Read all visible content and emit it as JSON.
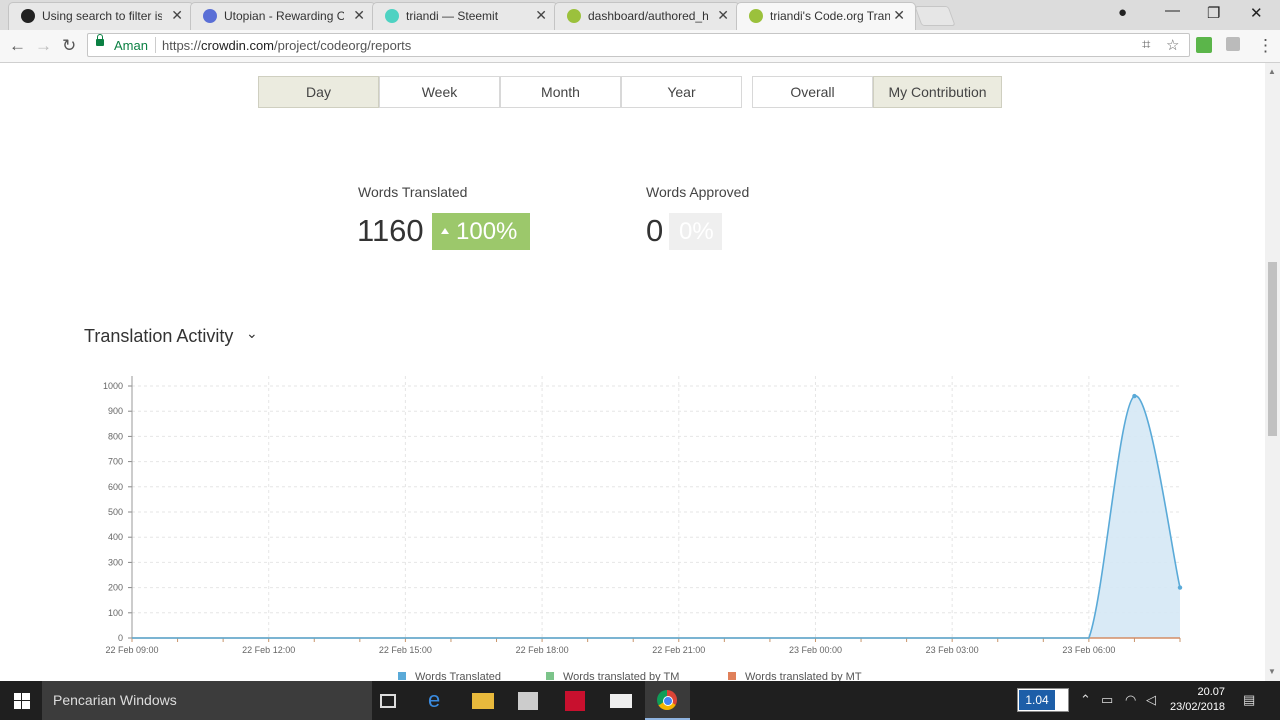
{
  "browser": {
    "tabs": [
      {
        "title": "Using search to filter issu",
        "favicon_color": "#222222"
      },
      {
        "title": "Utopian - Rewarding Op",
        "favicon_color": "#5a6fd6"
      },
      {
        "title": "triandi — Steemit",
        "favicon_color": "#4ed2c2"
      },
      {
        "title": "dashboard/authored_hin",
        "favicon_color": "#9bc13c"
      },
      {
        "title": "triandi's Code.org Transla",
        "favicon_color": "#9bc13c"
      }
    ],
    "secure_label": "Aman",
    "url_prefix": "https://",
    "url_host": "crowdin.com",
    "url_path": "/project/codeorg/reports"
  },
  "filters": {
    "periods": [
      "Day",
      "Week",
      "Month",
      "Year"
    ],
    "active_period": "Day",
    "scopes": [
      "Overall",
      "My Contribution"
    ],
    "active_scope": "My Contribution"
  },
  "stats": {
    "words_translated_label": "Words Translated",
    "words_translated_value": "1160",
    "words_translated_change": "100%",
    "words_approved_label": "Words Approved",
    "words_approved_value": "0",
    "words_approved_change": "0%"
  },
  "section": {
    "title": "Translation Activity"
  },
  "chart_data": {
    "type": "area",
    "title": "Translation Activity",
    "xlabel": "",
    "ylabel": "",
    "ylim": [
      0,
      1000
    ],
    "yticks": [
      0,
      100,
      200,
      300,
      400,
      500,
      600,
      700,
      800,
      900,
      1000
    ],
    "x_tick_labels": [
      "22 Feb 09:00",
      "22 Feb 12:00",
      "22 Feb 15:00",
      "22 Feb 18:00",
      "22 Feb 21:00",
      "23 Feb 00:00",
      "23 Feb 03:00",
      "23 Feb 06:00"
    ],
    "x": [
      "22 Feb 09:00",
      "22 Feb 10:00",
      "22 Feb 11:00",
      "22 Feb 12:00",
      "22 Feb 13:00",
      "22 Feb 14:00",
      "22 Feb 15:00",
      "22 Feb 16:00",
      "22 Feb 17:00",
      "22 Feb 18:00",
      "22 Feb 19:00",
      "22 Feb 20:00",
      "22 Feb 21:00",
      "22 Feb 22:00",
      "22 Feb 23:00",
      "23 Feb 00:00",
      "23 Feb 01:00",
      "23 Feb 02:00",
      "23 Feb 03:00",
      "23 Feb 04:00",
      "23 Feb 05:00",
      "23 Feb 06:00",
      "23 Feb 07:00",
      "23 Feb 08:00"
    ],
    "series": [
      {
        "name": "Words Translated",
        "color": "#5aaad8",
        "values": [
          0,
          0,
          0,
          0,
          0,
          0,
          0,
          0,
          0,
          0,
          0,
          0,
          0,
          0,
          0,
          0,
          0,
          0,
          0,
          0,
          0,
          0,
          960,
          200
        ]
      },
      {
        "name": "Words translated by TM",
        "color": "#7cc48a",
        "values": [
          0,
          0,
          0,
          0,
          0,
          0,
          0,
          0,
          0,
          0,
          0,
          0,
          0,
          0,
          0,
          0,
          0,
          0,
          0,
          0,
          0,
          0,
          0,
          0
        ]
      },
      {
        "name": "Words translated by MT",
        "color": "#e0805a",
        "values": [
          0,
          0,
          0,
          0,
          0,
          0,
          0,
          0,
          0,
          0,
          0,
          0,
          0,
          0,
          0,
          0,
          0,
          0,
          0,
          0,
          0,
          0,
          0,
          0
        ]
      }
    ],
    "grid": true,
    "legend": "bottom"
  },
  "taskbar": {
    "search_placeholder": "Pencarian Windows",
    "version_value": "1.04",
    "time": "20.07",
    "date": "23/02/2018"
  }
}
